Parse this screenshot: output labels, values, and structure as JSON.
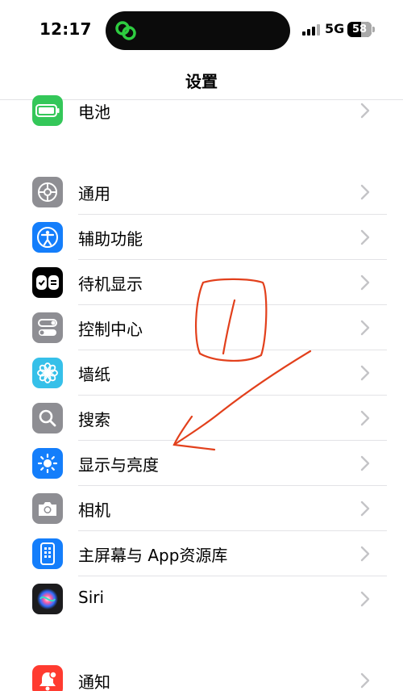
{
  "status_bar": {
    "time": "12:17",
    "network": "5G",
    "battery_percent": "58",
    "battery_level": 0.58
  },
  "nav": {
    "title": "设置"
  },
  "groups": [
    {
      "items": [
        {
          "label": "电池",
          "icon": "battery-icon",
          "color": "#34c759"
        }
      ]
    },
    {
      "items": [
        {
          "label": "通用",
          "icon": "gear-icon",
          "color": "#8e8e93"
        },
        {
          "label": "辅助功能",
          "icon": "accessibility-icon",
          "color": "#147efb"
        },
        {
          "label": "待机显示",
          "icon": "standby-icon",
          "color": "#000000"
        },
        {
          "label": "控制中心",
          "icon": "control-center-icon",
          "color": "#8e8e93"
        },
        {
          "label": "墙纸",
          "icon": "wallpaper-flower-icon",
          "color": "#36c0e9"
        },
        {
          "label": "搜索",
          "icon": "search-icon",
          "color": "#8e8e93"
        },
        {
          "label": "显示与亮度",
          "icon": "brightness-sun-icon",
          "color": "#147efb"
        },
        {
          "label": "相机",
          "icon": "camera-icon",
          "color": "#8e8e93"
        },
        {
          "label": "主屏幕与 App资源库",
          "icon": "home-screen-icon",
          "color": "#147efb"
        },
        {
          "label": "Siri",
          "icon": "siri-icon",
          "color": "#1c1c1e"
        }
      ]
    },
    {
      "items": [
        {
          "label": "通知",
          "icon": "notification-bell-icon",
          "color": "#ff3b30"
        }
      ]
    }
  ],
  "annotation_color": "#e2401c"
}
